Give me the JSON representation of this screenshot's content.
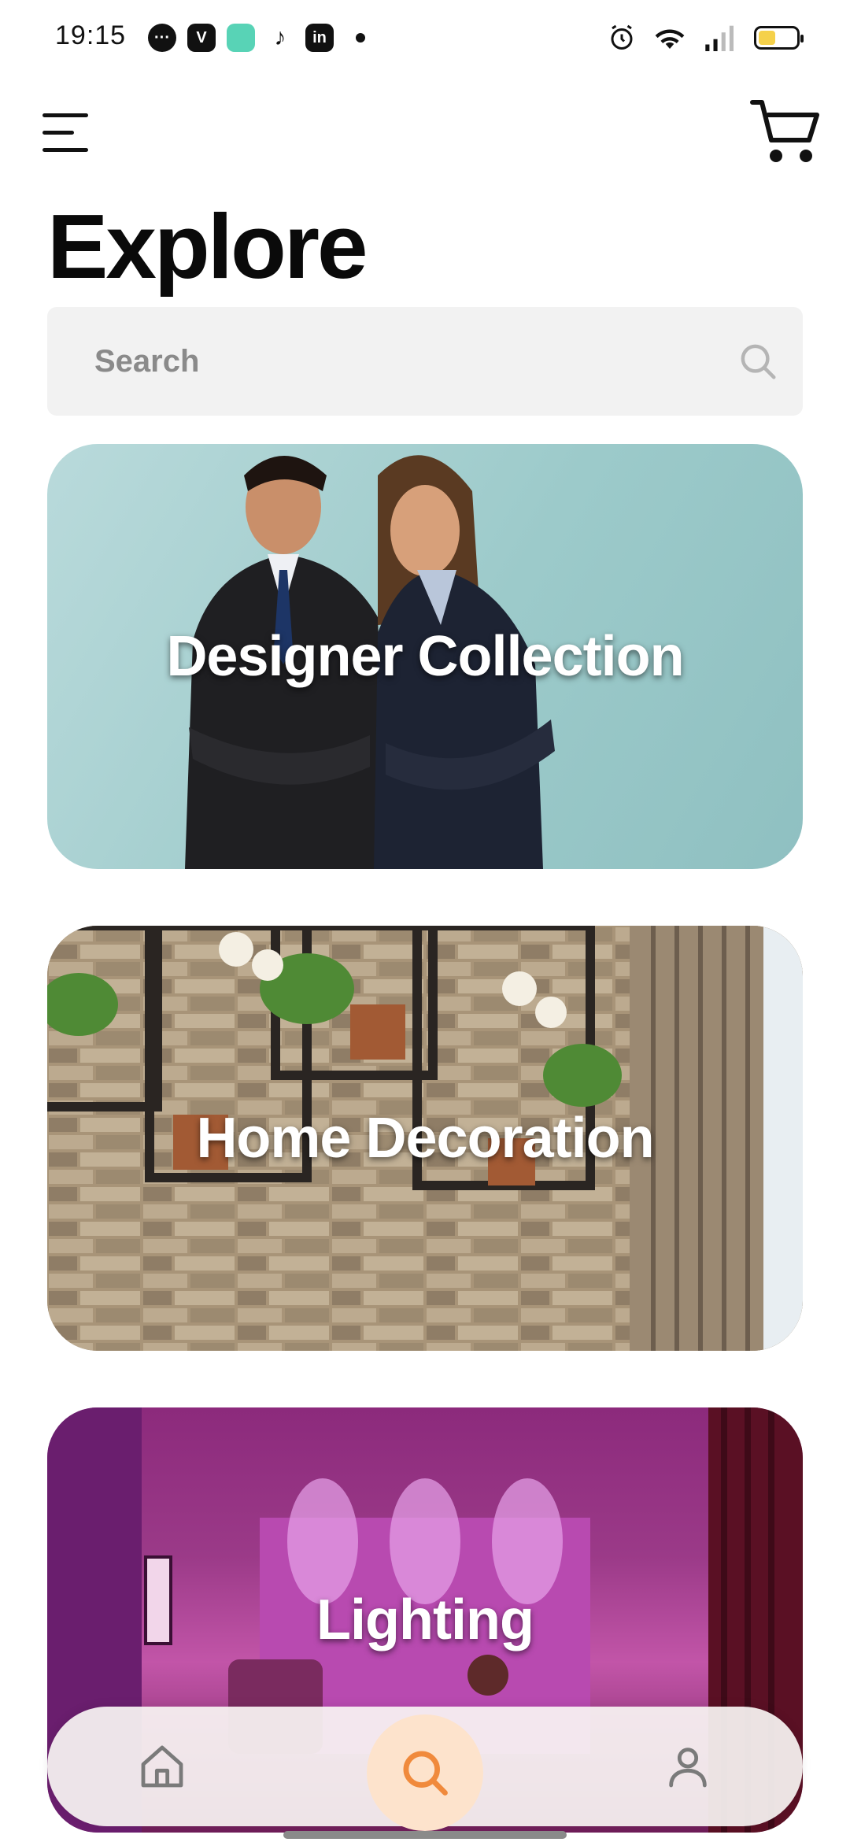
{
  "status_bar": {
    "time": "19:15"
  },
  "header": {
    "title": "Explore"
  },
  "search": {
    "placeholder": "Search"
  },
  "categories": [
    {
      "label": "Designer Collection"
    },
    {
      "label": "Home Decoration"
    },
    {
      "label": "Lighting"
    }
  ],
  "bottom_nav": {
    "items": [
      {
        "icon": "home-icon",
        "active": false
      },
      {
        "icon": "search-icon",
        "active": true
      },
      {
        "icon": "profile-icon",
        "active": false
      }
    ],
    "accent_color": "#f08a3c"
  }
}
